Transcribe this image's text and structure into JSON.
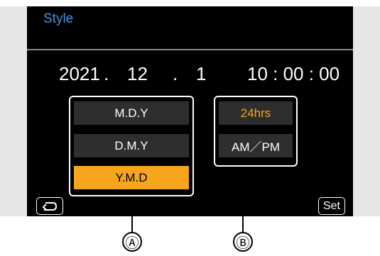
{
  "header": {
    "title": "Style"
  },
  "datetime": {
    "year": "2021",
    "sep1": ".",
    "month": "12",
    "sep2": ".",
    "day": "1",
    "time": "10 : 00 : 00"
  },
  "date_format": {
    "options": [
      "M.D.Y",
      "D.M.Y",
      "Y.M.D"
    ],
    "selected": "Y.M.D"
  },
  "time_format": {
    "options": [
      "24hrs",
      "AM／PM"
    ],
    "selected": "24hrs"
  },
  "buttons": {
    "back_icon": "return-arrow-icon",
    "set_label": "Set"
  },
  "callouts": {
    "a": "Ⓐ",
    "b": "Ⓑ"
  },
  "colors": {
    "accent": "#f7a51c",
    "title": "#4a90e2",
    "background": "#000000"
  }
}
